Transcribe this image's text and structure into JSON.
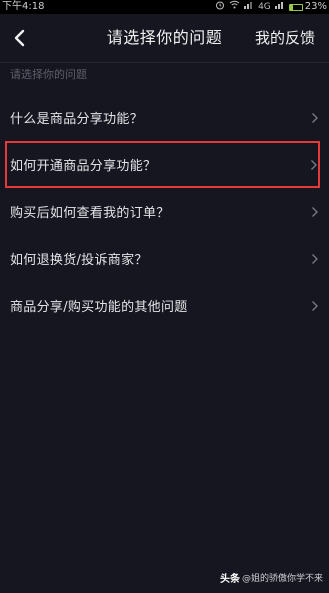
{
  "status_bar": {
    "time": "下午4:18",
    "network": "4G",
    "battery_percent_text": "23%",
    "battery_level": 0.23
  },
  "nav": {
    "title": "请选择你的问题",
    "feedback_label": "我的反馈"
  },
  "section_label": "请选择你的问题",
  "items": [
    {
      "label": "什么是商品分享功能？"
    },
    {
      "label": "如何开通商品分享功能？"
    },
    {
      "label": "购买后如何查看我的订单？"
    },
    {
      "label": "如何退换货/投诉商家？"
    },
    {
      "label": "商品分享/购买功能的其他问题"
    }
  ],
  "watermark": {
    "brand": "头条",
    "account": "@姐的骄傲你学不来"
  },
  "colors": {
    "background": "#15161f",
    "highlight_border": "#e53a3a",
    "battery": "#9cc84a"
  }
}
